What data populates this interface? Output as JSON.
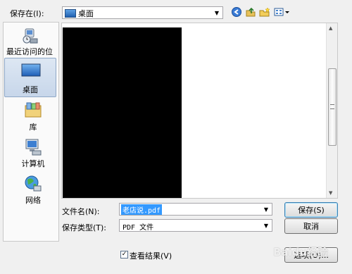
{
  "header": {
    "save_in_label": "保存在(I):",
    "save_in_value": "桌面"
  },
  "places": [
    {
      "label": "最近访问的位置",
      "icon": "recent-places-icon"
    },
    {
      "label": "桌面",
      "icon": "desktop-icon"
    },
    {
      "label": "库",
      "icon": "libraries-icon"
    },
    {
      "label": "计算机",
      "icon": "computer-icon"
    },
    {
      "label": "网络",
      "icon": "network-icon"
    }
  ],
  "toolbar_icons": [
    "back-icon",
    "up-folder-icon",
    "new-folder-icon",
    "view-menu-icon"
  ],
  "filename": {
    "label": "文件名(N):",
    "value": "老店说.pdf"
  },
  "filetype": {
    "label": "保存类型(T):",
    "value": "PDF 文件"
  },
  "buttons": {
    "save": "保存(S)",
    "cancel": "取消",
    "options": "选项(O)..."
  },
  "view_result": {
    "label": "查看结果(V)",
    "checked": true
  },
  "watermark": "Baidu经验",
  "colors": {
    "selection": "#3399ff",
    "accent": "#3c7fb1"
  }
}
